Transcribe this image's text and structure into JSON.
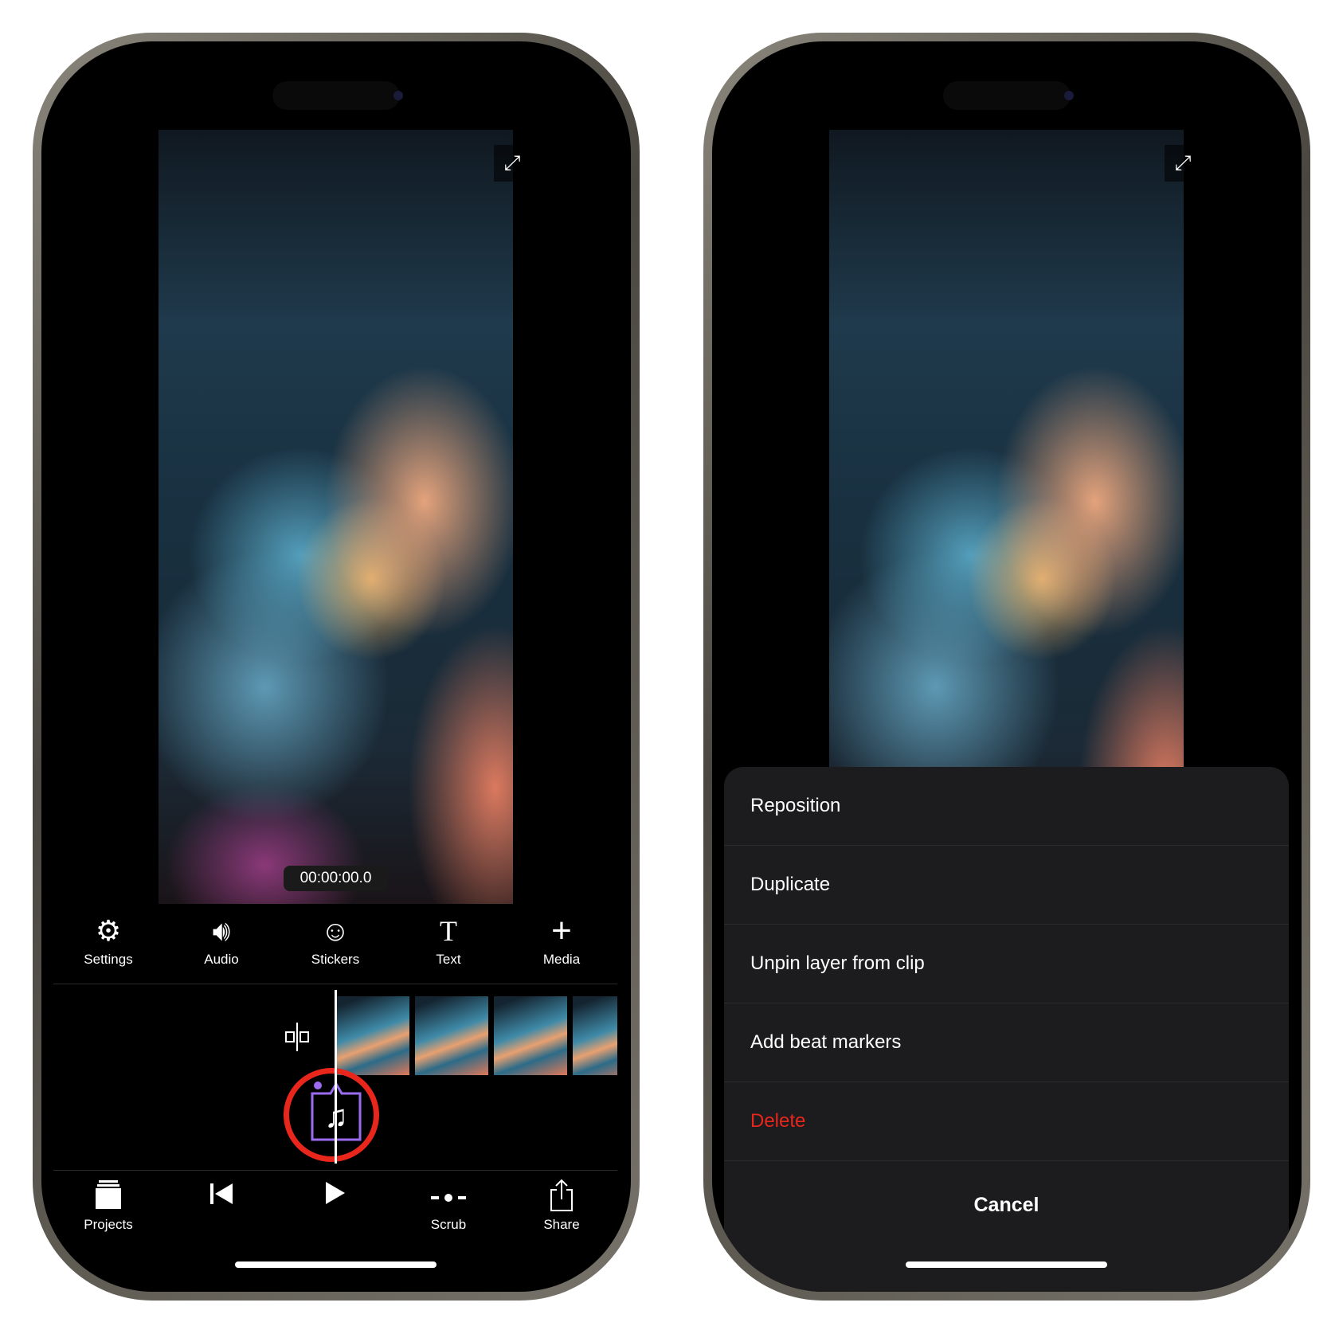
{
  "left_phone": {
    "timecode": "00:00:00.0",
    "expand_icon": "expand-arrows-icon",
    "toolbar": [
      {
        "label": "Settings",
        "icon": "gear-icon"
      },
      {
        "label": "Audio",
        "icon": "speaker-icon"
      },
      {
        "label": "Stickers",
        "icon": "smiley-icon"
      },
      {
        "label": "Text",
        "icon": "text-icon"
      },
      {
        "label": "Media",
        "icon": "plus-icon"
      }
    ],
    "timeline": {
      "split_icon": "split-icon",
      "audio_layer_icon": "music-note-icon",
      "highlight_color": "#e8261c",
      "audio_layer_color": "#9b6bf0"
    },
    "bottom_bar": [
      {
        "label": "Projects",
        "icon": "projects-stack-icon"
      },
      {
        "label": "",
        "icon": "skip-back-icon"
      },
      {
        "label": "",
        "icon": "play-icon"
      },
      {
        "label": "Scrub",
        "icon": "scrub-icon"
      },
      {
        "label": "Share",
        "icon": "share-icon"
      }
    ]
  },
  "right_phone": {
    "action_sheet": {
      "items": [
        {
          "label": "Reposition"
        },
        {
          "label": "Duplicate"
        },
        {
          "label": "Unpin layer from clip"
        },
        {
          "label": "Add beat markers"
        },
        {
          "label": "Delete",
          "destructive": true
        }
      ],
      "cancel_label": "Cancel",
      "destructive_color": "#e8261c"
    }
  }
}
